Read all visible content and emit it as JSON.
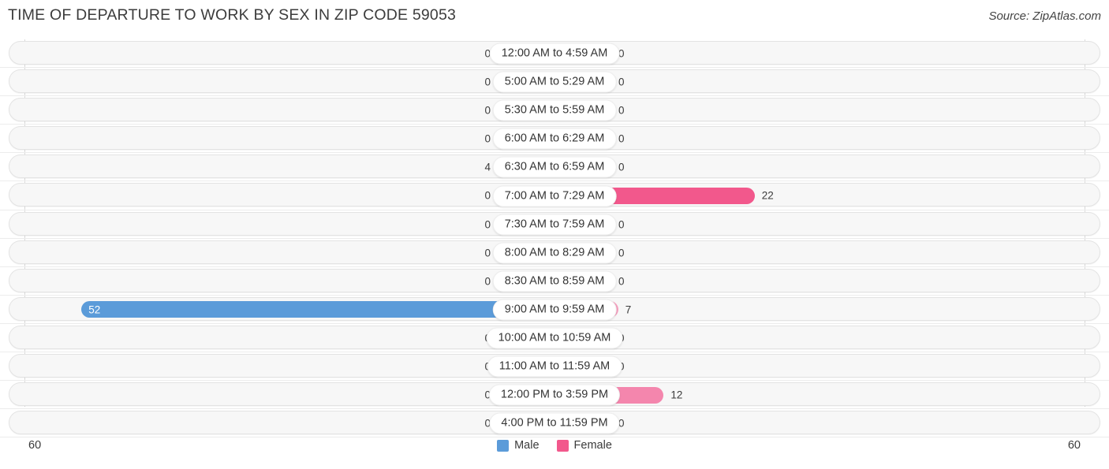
{
  "header": {
    "title": "TIME OF DEPARTURE TO WORK BY SEX IN ZIP CODE 59053",
    "source": "Source: ZipAtlas.com"
  },
  "axis": {
    "left_max_label": "60",
    "right_max_label": "60",
    "max": 60
  },
  "legend": {
    "male_label": "Male",
    "female_label": "Female",
    "male_color": "#5B9BD9",
    "female_color": "#F2588C"
  },
  "chart_data": {
    "type": "bar",
    "title": "TIME OF DEPARTURE TO WORK BY SEX IN ZIP CODE 59053",
    "subtitle": "Source: ZipAtlas.com",
    "orientation": "horizontal-diverging",
    "xlabel": "",
    "ylabel": "",
    "xlim": [
      60,
      60
    ],
    "grid": true,
    "legend_position": "bottom-center",
    "categories": [
      "12:00 AM to 4:59 AM",
      "5:00 AM to 5:29 AM",
      "5:30 AM to 5:59 AM",
      "6:00 AM to 6:29 AM",
      "6:30 AM to 6:59 AM",
      "7:00 AM to 7:29 AM",
      "7:30 AM to 7:59 AM",
      "8:00 AM to 8:29 AM",
      "8:30 AM to 8:59 AM",
      "9:00 AM to 9:59 AM",
      "10:00 AM to 10:59 AM",
      "11:00 AM to 11:59 AM",
      "12:00 PM to 3:59 PM",
      "4:00 PM to 11:59 PM"
    ],
    "series": [
      {
        "name": "Male",
        "values": [
          0,
          0,
          0,
          0,
          4,
          0,
          0,
          0,
          0,
          52,
          0,
          0,
          0,
          0
        ]
      },
      {
        "name": "Female",
        "values": [
          0,
          0,
          0,
          0,
          0,
          22,
          0,
          0,
          0,
          7,
          0,
          0,
          12,
          0
        ]
      }
    ]
  },
  "rows": [
    {
      "label": "12:00 AM to 4:59 AM",
      "male": "0",
      "female": "0",
      "male_value": 0,
      "female_value": 0
    },
    {
      "label": "5:00 AM to 5:29 AM",
      "male": "0",
      "female": "0",
      "male_value": 0,
      "female_value": 0
    },
    {
      "label": "5:30 AM to 5:59 AM",
      "male": "0",
      "female": "0",
      "male_value": 0,
      "female_value": 0
    },
    {
      "label": "6:00 AM to 6:29 AM",
      "male": "0",
      "female": "0",
      "male_value": 0,
      "female_value": 0
    },
    {
      "label": "6:30 AM to 6:59 AM",
      "male": "4",
      "female": "0",
      "male_value": 4,
      "female_value": 0
    },
    {
      "label": "7:00 AM to 7:29 AM",
      "male": "0",
      "female": "22",
      "male_value": 0,
      "female_value": 22
    },
    {
      "label": "7:30 AM to 7:59 AM",
      "male": "0",
      "female": "0",
      "male_value": 0,
      "female_value": 0
    },
    {
      "label": "8:00 AM to 8:29 AM",
      "male": "0",
      "female": "0",
      "male_value": 0,
      "female_value": 0
    },
    {
      "label": "8:30 AM to 8:59 AM",
      "male": "0",
      "female": "0",
      "male_value": 0,
      "female_value": 0
    },
    {
      "label": "9:00 AM to 9:59 AM",
      "male": "52",
      "female": "7",
      "male_value": 52,
      "female_value": 7
    },
    {
      "label": "10:00 AM to 10:59 AM",
      "male": "0",
      "female": "0",
      "male_value": 0,
      "female_value": 0
    },
    {
      "label": "11:00 AM to 11:59 AM",
      "male": "0",
      "female": "0",
      "male_value": 0,
      "female_value": 0
    },
    {
      "label": "12:00 PM to 3:59 PM",
      "male": "0",
      "female": "12",
      "male_value": 0,
      "female_value": 12
    },
    {
      "label": "4:00 PM to 11:59 PM",
      "male": "0",
      "female": "0",
      "male_value": 0,
      "female_value": 0
    }
  ]
}
